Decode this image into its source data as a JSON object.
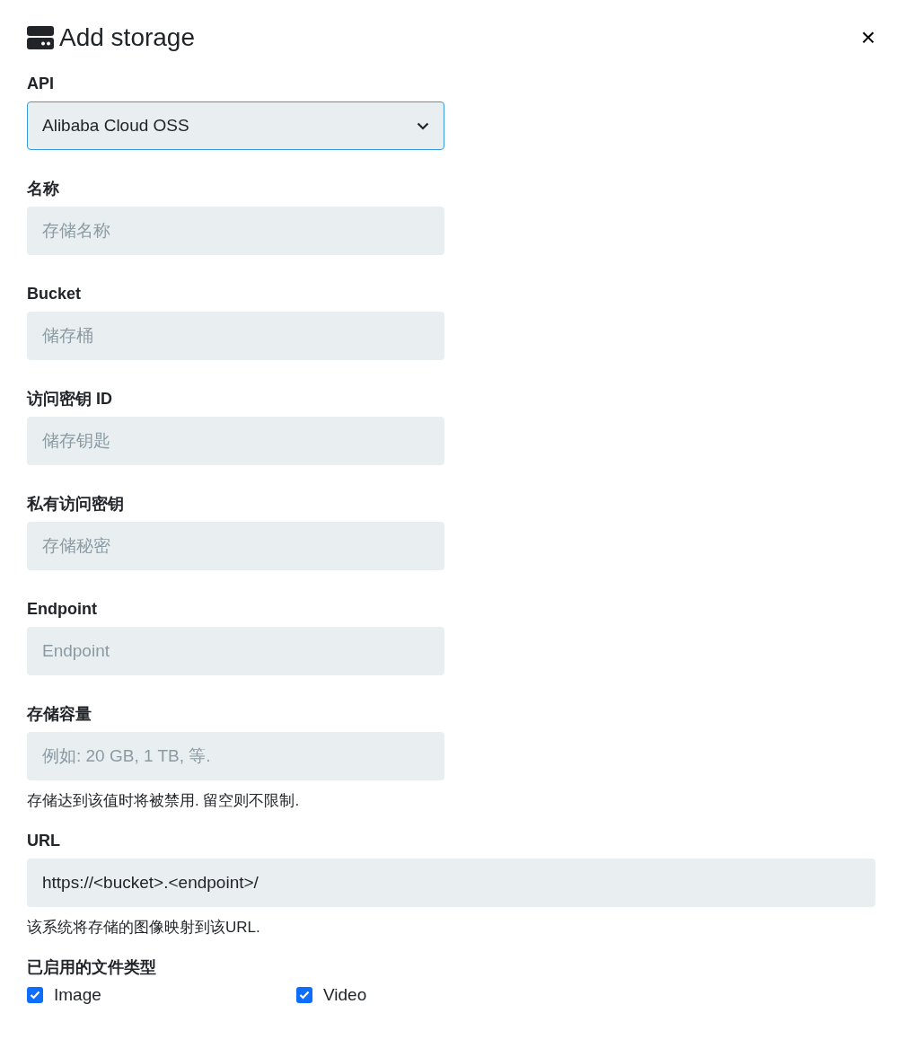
{
  "dialog": {
    "title": "Add storage",
    "close": "×"
  },
  "fields": [
    {
      "kind": "select",
      "label": "API",
      "value": "Alibaba Cloud OSS",
      "focused": true,
      "wide": false
    },
    {
      "kind": "text",
      "label": "名称",
      "placeholder": "存储名称",
      "wide": false
    },
    {
      "kind": "text",
      "label": "Bucket",
      "placeholder": "储存桶",
      "wide": false
    },
    {
      "kind": "text",
      "label": "访问密钥 ID",
      "placeholder": "储存钥匙",
      "wide": false
    },
    {
      "kind": "text",
      "label": "私有访问密钥",
      "placeholder": "存储秘密",
      "wide": false
    },
    {
      "kind": "text",
      "label": "Endpoint",
      "placeholder": "Endpoint",
      "wide": false
    },
    {
      "kind": "text",
      "label": "存储容量",
      "placeholder": "例如: 20 GB, 1 TB, 等.",
      "hint": "存储达到该值时将被禁用. 留空则不限制.",
      "wide": false
    },
    {
      "kind": "text",
      "label": "URL",
      "value": "https://<bucket>.<endpoint>/",
      "hint": "该系统将存储的图像映射到该URL.",
      "wide": true
    }
  ],
  "file_types": {
    "label": "已启用的文件类型",
    "options": [
      {
        "label": "Image",
        "checked": true
      },
      {
        "label": "Video",
        "checked": true
      }
    ]
  }
}
